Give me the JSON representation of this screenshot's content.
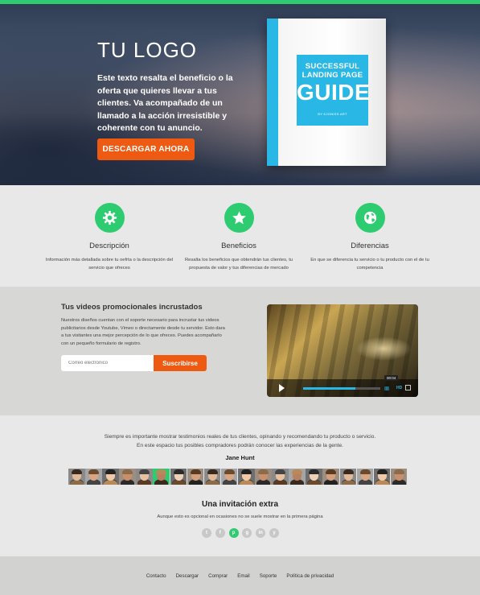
{
  "hero": {
    "logo": "TU LOGO",
    "text": "Este texto resalta el beneficio o la oferta que quieres llevar a tus clientes. Va acompañado de un llamado a la acción irresistible y coherente con tu anuncio.",
    "cta_label": "DESCARGAR AHORA",
    "book": {
      "line1": "SUCCESSFUL",
      "line2": "LANDING PAGE",
      "line3": "GUIDE",
      "byline": "BY KJONISS ART"
    }
  },
  "features": [
    {
      "icon": "gear-icon",
      "title": "Descripción",
      "desc": "Información más detallada sobre tu oefrta o la descripción del servicio que ofreces"
    },
    {
      "icon": "star-icon",
      "title": "Beneficios",
      "desc": "Resalta los beneficios que obtendrán tus clientes, tu propuesta de valor y tus diferencias de mercado"
    },
    {
      "icon": "globe-icon",
      "title": "Diferencias",
      "desc": "En que se diferencia tu servicio o tu producto con el de tu competencia"
    }
  ],
  "video_section": {
    "title": "Tus videos promocionales incrustados",
    "text": "Nuestros diseños cuentan con el soporte necesario para incrustar tus videos publicitarios desde Youtube, Vimeo o directamente desde tu servidor. Esto dara a tus visitantes una mejor percepción de lo que ofreces. Puedes acompañarlo con un pequeño formulario de registro.",
    "email_placeholder": "Correo electrónico",
    "subscribe_label": "Suscribirse",
    "video": {
      "timecode": "00:04",
      "progress": 0.68,
      "hd_label": "HD"
    }
  },
  "testimonials": {
    "text_line1": "Siempre es importante mostrar testimonios reales de tus clientes, opinando y recomendando tu producto o servicio.",
    "text_line2": "En este espacio tus posibles compradores podrán conocer las experiencias de la gente.",
    "name": "Jane Hunt",
    "face_count": 20,
    "active_face": 5
  },
  "invitation": {
    "title": "Una invitación extra",
    "subtitle": "Aunque esto es opcional en ocasiones no se suele mostrar en la primera página",
    "socials": [
      {
        "name": "twitter-icon",
        "glyph": "t",
        "active": false
      },
      {
        "name": "facebook-icon",
        "glyph": "f",
        "active": false
      },
      {
        "name": "pinterest-icon",
        "glyph": "p",
        "active": true
      },
      {
        "name": "google-plus-icon",
        "glyph": "g",
        "active": false
      },
      {
        "name": "linkedin-icon",
        "glyph": "in",
        "active": false
      },
      {
        "name": "youtube-icon",
        "glyph": "y",
        "active": false
      }
    ]
  },
  "footer": {
    "links": [
      "Contacto",
      "Descargar",
      "Comprar",
      "Email",
      "Soporte",
      "Política de privacidad"
    ]
  },
  "colors": {
    "accent_green": "#2ecc71",
    "cta_orange": "#ee5a12",
    "book_blue": "#29b7e6"
  }
}
